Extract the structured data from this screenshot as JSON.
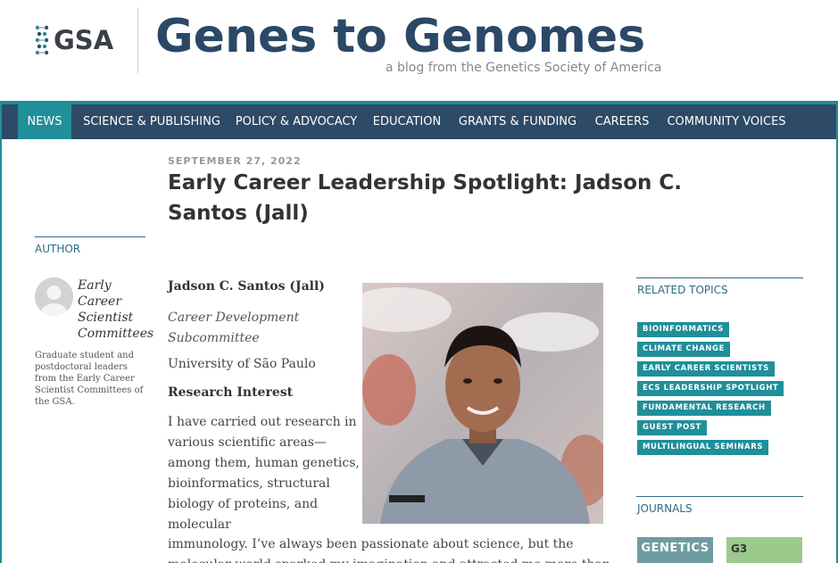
{
  "header": {
    "logo_text": "GSA",
    "site_title": "Genes to Genomes",
    "tagline": "a blog from the Genetics Society of America"
  },
  "nav": {
    "items": [
      {
        "label": "NEWS",
        "active": true
      },
      {
        "label": "SCIENCE & PUBLISHING",
        "active": false
      },
      {
        "label": "POLICY & ADVOCACY",
        "active": false
      },
      {
        "label": "EDUCATION",
        "active": false
      },
      {
        "label": "GRANTS & FUNDING",
        "active": false
      },
      {
        "label": "CAREERS",
        "active": false
      },
      {
        "label": "COMMUNITY VOICES",
        "active": false
      }
    ]
  },
  "post": {
    "date": "SEPTEMBER 27, 2022",
    "title": "Early Career Leadership Spotlight: Jadson C. Santos (Jall)"
  },
  "author": {
    "heading": "AUTHOR",
    "name": "Early Career Scientist Committees",
    "description": "Graduate student and postdoctoral leaders from the Early Career Scientist Committees of the GSA."
  },
  "article": {
    "person_name": "Jadson C. Santos (Jall)",
    "subcommittee": "Career Development Subcommittee",
    "institution": "University of São Paulo",
    "section_heading": "Research Interest",
    "research_text": "I have carried out research in various scientific areas—among them, human genetics, bioinformatics, structural biology of proteins, and molecular",
    "research_text_wide": "immunology. I’ve always been passionate about science, but the",
    "research_text_cut": "molecular world sparked my imagination and attracted me more than"
  },
  "sidebar": {
    "related_heading": "RELATED TOPICS",
    "tags": [
      "BIOINFORMATICS",
      "CLIMATE CHANGE",
      "EARLY CAREER SCIENTISTS",
      "ECS LEADERSHIP SPOTLIGHT",
      "FUNDAMENTAL RESEARCH",
      "GUEST POST",
      "MULTILINGUAL SEMINARS"
    ],
    "journals_heading": "JOURNALS",
    "journals": [
      "GENETICS",
      "G3"
    ]
  },
  "colors": {
    "nav_bg": "#2d4a66",
    "accent_teal": "#1f8f9a",
    "title_blue": "#2b4866"
  }
}
